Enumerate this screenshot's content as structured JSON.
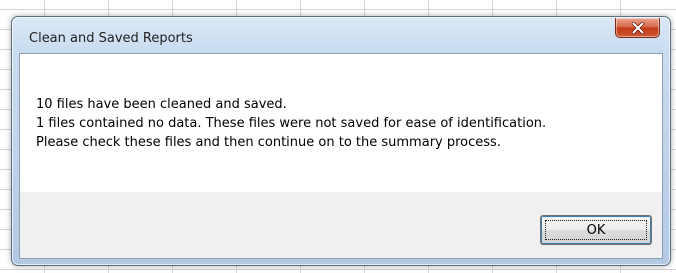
{
  "dialog": {
    "title": "Clean and Saved Reports",
    "close_icon": "close-x-icon",
    "message_lines": [
      "10 files have been cleaned and saved.",
      "1 files contained no data. These files were not saved for ease of identification.",
      "Please check these files and then continue on to the summary process."
    ],
    "ok_label": "OK"
  },
  "colors": {
    "close_button": "#c23a17",
    "frame": "#bfd3ea",
    "focus_ring": "#3c7fb1"
  }
}
